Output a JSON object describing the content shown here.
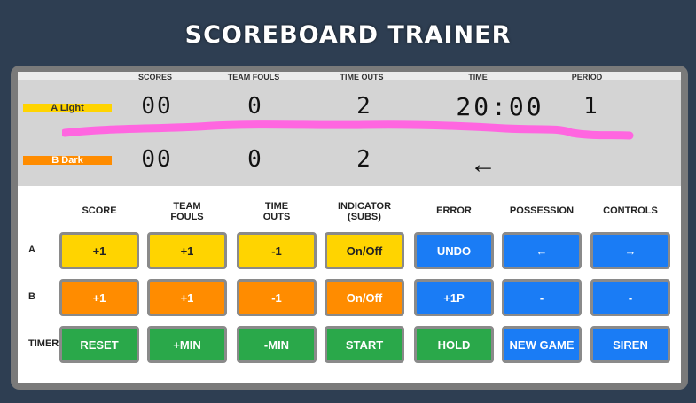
{
  "title": "SCOREBOARD TRAINER",
  "board": {
    "headers": [
      "SCORES",
      "TEAM FOULS",
      "TIME OUTS",
      "TIME",
      "PERIOD"
    ],
    "teamA": {
      "name": "A Light",
      "score": "00",
      "fouls": "0",
      "timeouts": "2"
    },
    "teamB": {
      "name": "B Dark",
      "score": "00",
      "fouls": "0",
      "timeouts": "2"
    },
    "time": "20:00",
    "period": "1",
    "possession_arrow": "←"
  },
  "controls": {
    "columns": [
      "SCORE",
      "TEAM\nFOULS",
      "TIME\nOUTS",
      "INDICATOR\n(SUBS)",
      "ERROR",
      "POSSESSION",
      "CONTROLS"
    ],
    "rows": [
      {
        "label": "A",
        "buttons": [
          "+1",
          "+1",
          "-1",
          "On/Off",
          "UNDO",
          "←",
          "→"
        ]
      },
      {
        "label": "B",
        "buttons": [
          "+1",
          "+1",
          "-1",
          "On/Off",
          "+1P",
          "-",
          "-"
        ]
      },
      {
        "label": "TIMER",
        "buttons": [
          "RESET",
          "+MIN",
          "-MIN",
          "START",
          "HOLD",
          "NEW GAME",
          "SIREN"
        ]
      }
    ]
  },
  "colors": {
    "yellow": "#ffd400",
    "orange": "#ff8c00",
    "blue": "#1a7cf5",
    "green": "#2aa84a",
    "background": "#2e3e52",
    "scribble": "#ff66e0"
  }
}
